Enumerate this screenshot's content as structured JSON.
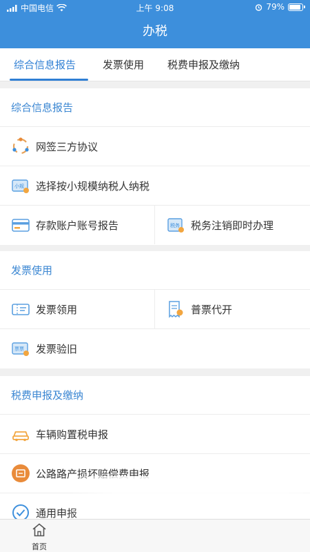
{
  "status_bar": {
    "carrier": "中国电信",
    "time": "上午 9:08",
    "battery": "79%",
    "icons": [
      "signal-icon",
      "wifi-icon",
      "alarm-icon",
      "battery-icon"
    ]
  },
  "nav": {
    "title": "办税"
  },
  "tabs": [
    {
      "label": "综合信息报告",
      "active": true
    },
    {
      "label": "发票使用",
      "active": false
    },
    {
      "label": "税费申报及缴纳",
      "active": false
    }
  ],
  "sections": {
    "info_report": {
      "title": "综合信息报告",
      "items": {
        "online_agreement": "网签三方协议",
        "small_scale": "选择按小规模纳税人纳税",
        "bank_account": "存款账户账号报告",
        "deregistration": "税务注销即时办理"
      }
    },
    "invoice_use": {
      "title": "发票使用",
      "items": {
        "invoice_claim": "发票领用",
        "general_invoice": "普票代开",
        "invoice_check": "发票验旧"
      }
    },
    "tax_filing": {
      "title": "税费申报及缴纳",
      "items": {
        "vehicle_tax": "车辆购置税申报",
        "road_damage": "公路路产损坏赔偿费申报",
        "general_filing": "通用申报"
      }
    }
  },
  "tabbar": {
    "home_label": "首页"
  },
  "colors": {
    "primary": "#3d8fdc",
    "section_title": "#3a86d2",
    "accent_orange": "#e98b3a"
  }
}
